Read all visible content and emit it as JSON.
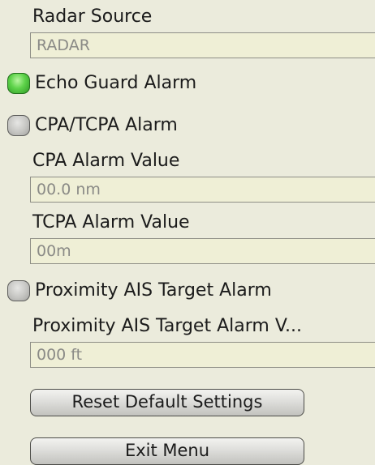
{
  "radar_source": {
    "label": "Radar Source",
    "value": "RADAR"
  },
  "echo_guard": {
    "label": "Echo Guard Alarm",
    "state": "on",
    "indicator_color": "#4cc23a"
  },
  "cpa_tcpa": {
    "label": "CPA/TCPA Alarm",
    "state": "off"
  },
  "cpa_value": {
    "label": "CPA Alarm Value",
    "value": "00.0 nm"
  },
  "tcpa_value": {
    "label": "TCPA Alarm Value",
    "value": "00m"
  },
  "proximity_ais": {
    "label": "Proximity AIS Target Alarm",
    "state": "off"
  },
  "proximity_value": {
    "label": "Proximity AIS Target Alarm V...",
    "value": "000 ft"
  },
  "buttons": {
    "reset_label": "Reset Default Settings",
    "exit_label": "Exit Menu"
  },
  "colors": {
    "background": "#ebebdc",
    "field_text": "#8a8a86"
  }
}
